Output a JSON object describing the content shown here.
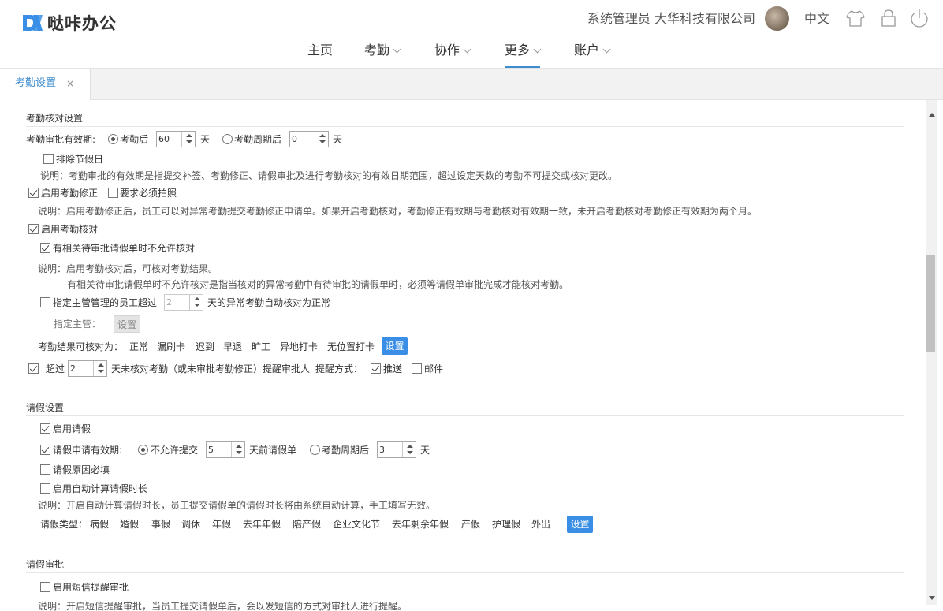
{
  "app": {
    "brand": "哒咔办公",
    "brand_color": "#3a8ee6"
  },
  "header": {
    "user_info": "系统管理员 大华科技有限公司",
    "language": "中文",
    "icons": [
      "tshirt-icon",
      "lock-icon",
      "power-icon"
    ]
  },
  "nav": {
    "items": [
      {
        "label": "主页"
      },
      {
        "label": "考勤"
      },
      {
        "label": "协作"
      },
      {
        "label": "更多",
        "active": true
      },
      {
        "label": "账户"
      }
    ]
  },
  "tabs": [
    {
      "label": "考勤设置",
      "close": "×"
    }
  ],
  "attendance_check": {
    "title": "考勤核对设置",
    "validity_label": "考勤审批有效期:",
    "opt_after_label": "考勤后",
    "opt_after_value": "60",
    "day_unit": "天",
    "opt_cycle_label": "考勤周期后",
    "opt_cycle_value": "0",
    "exclude_holiday": "排除节假日",
    "note1": "说明：考勤审批的有效期是指提交补签、考勤修正、请假审批及进行考勤核对的有效日期范围，超过设定天数的考勤不可提交或核对更改。",
    "enable_correction": "启用考勤修正",
    "require_photo": "要求必须拍照",
    "note2": "说明：启用考勤修正后，员工可以对异常考勤提交考勤修正申请单。如果开启考勤核对，考勤修正有效期与考勤核对有效期一致，未开启考勤核对考勤修正有效期为两个月。",
    "enable_check": "启用考勤核对",
    "disallow_pending": "有相关待审批请假单时不允许核对",
    "note3a": "说明：启用考勤核对后，可核对考勤结果。",
    "note3b": "有相关待审批请假单时不允许核对是指当核对的异常考勤中有待审批的请假单时，必须等请假单审批完成才能核对考勤。",
    "auto_check_prefix": "指定主管管理的员工超过",
    "auto_check_value": "2",
    "auto_check_suffix": "天的异常考勤自动核对为正常",
    "manager_label": "指定主管：",
    "manager_button": "设置",
    "result_label": "考勤结果可核对为：",
    "result_options": [
      "正常",
      "漏刷卡",
      "迟到",
      "早退",
      "旷工",
      "异地打卡",
      "无位置打卡"
    ],
    "result_button": "设置",
    "remind_prefix": "超过",
    "remind_value": "2",
    "remind_suffix": "天未核对考勤（或未审批考勤修正）提醒审批人",
    "remind_method_label": "提醒方式：",
    "remind_push": "推送",
    "remind_email": "邮件"
  },
  "leave": {
    "title": "请假设置",
    "enable_leave": "启用请假",
    "validity_label": "请假申请有效期:",
    "opt_disallow_label": "不允许提交",
    "opt_disallow_value": "5",
    "before_label": "天前请假单",
    "opt_cycle_label": "考勤周期后",
    "opt_cycle_value": "3",
    "day_unit": "天",
    "reason_required": "请假原因必填",
    "auto_calc": "启用自动计算请假时长",
    "note": "说明：开启自动计算请假时长，员工提交请假单的请假时长将由系统自动计算，手工填写无效。",
    "types_label": "请假类型：",
    "types": [
      "病假",
      "婚假",
      "事假",
      "调休",
      "年假",
      "去年年假",
      "陪产假",
      "企业文化节",
      "去年剩余年假",
      "产假",
      "护理假",
      "外出"
    ],
    "types_button": "设置"
  },
  "leave_approval": {
    "title": "请假审批",
    "sms_remind": "启用短信提醒审批",
    "note": "说明：开启短信提醒审批，当员工提交请假单后，会以发短信的方式对审批人进行提醒。"
  }
}
